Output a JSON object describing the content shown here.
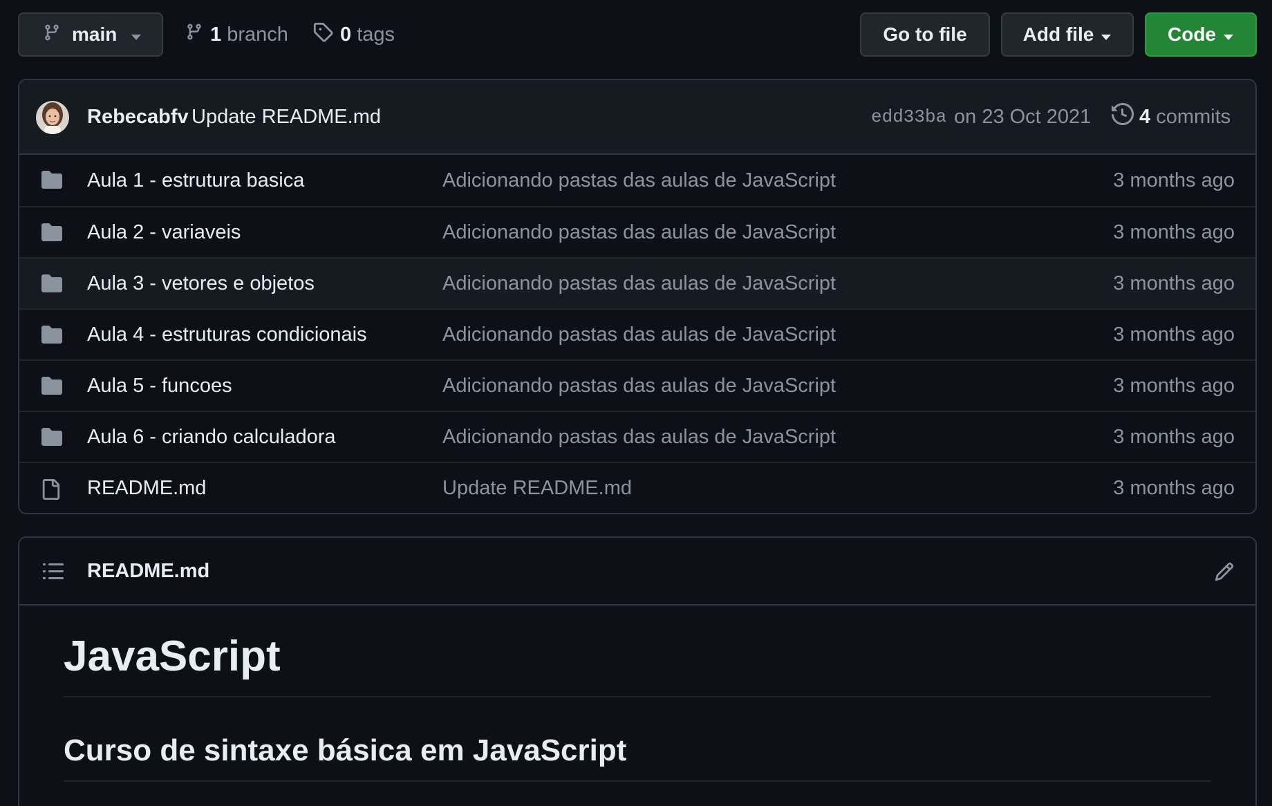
{
  "toolbar": {
    "branch_name": "main",
    "branches_count": "1",
    "branches_label": "branch",
    "tags_count": "0",
    "tags_label": "tags",
    "go_to_file": "Go to file",
    "add_file": "Add file",
    "code": "Code"
  },
  "latest_commit": {
    "author": "Rebecabfv",
    "message": "Update README.md",
    "sha": "edd33ba",
    "date": "on 23 Oct 2021",
    "commits_count": "4",
    "commits_label": "commits"
  },
  "files": [
    {
      "type": "folder-icon",
      "name": "Aula 1 - estrutura basica",
      "commit": "Adicionando pastas das aulas de JavaScript",
      "age": "3 months ago"
    },
    {
      "type": "folder-icon",
      "name": "Aula 2 - variaveis",
      "commit": "Adicionando pastas das aulas de JavaScript",
      "age": "3 months ago"
    },
    {
      "type": "folder-icon",
      "name": "Aula 3 - vetores e objetos",
      "commit": "Adicionando pastas das aulas de JavaScript",
      "age": "3 months ago"
    },
    {
      "type": "folder-icon",
      "name": "Aula 4 - estruturas condicionais",
      "commit": "Adicionando pastas das aulas de JavaScript",
      "age": "3 months ago"
    },
    {
      "type": "folder-icon",
      "name": "Aula 5 - funcoes",
      "commit": "Adicionando pastas das aulas de JavaScript",
      "age": "3 months ago"
    },
    {
      "type": "folder-icon",
      "name": "Aula 6 - criando calculadora",
      "commit": "Adicionando pastas das aulas de JavaScript",
      "age": "3 months ago"
    },
    {
      "type": "file-icon",
      "name": "README.md",
      "commit": "Update README.md",
      "age": "3 months ago"
    }
  ],
  "readme": {
    "title": "README.md",
    "h1": "JavaScript",
    "h2": "Curso de sintaxe básica em JavaScript"
  },
  "colors": {
    "background": "#0d1117",
    "code_button": "#238636",
    "muted_text": "#8b949e"
  }
}
